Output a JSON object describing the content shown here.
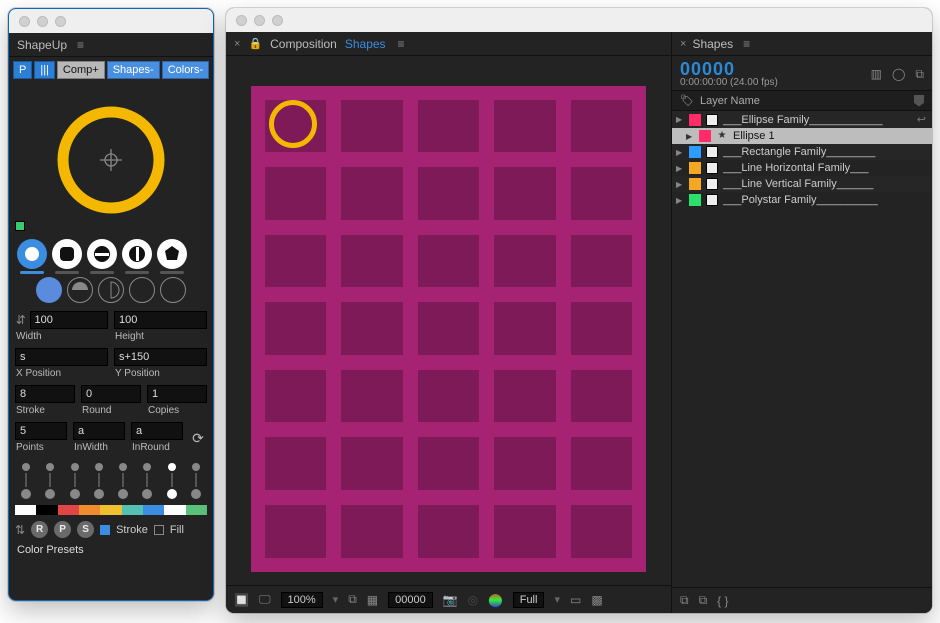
{
  "left_panel": {
    "title": "ShapeUp",
    "chips": [
      "P",
      "|||",
      "Comp+",
      "Shapes-",
      "Colors-"
    ],
    "width": {
      "value": "100",
      "label": "Width"
    },
    "height": {
      "value": "100",
      "label": "Height"
    },
    "xpos": {
      "value": "s",
      "label": "X Position"
    },
    "ypos": {
      "value": "s+150",
      "label": "Y Position"
    },
    "stroke": {
      "value": "8",
      "label": "Stroke"
    },
    "round": {
      "value": "0",
      "label": "Round"
    },
    "copies": {
      "value": "1",
      "label": "Copies"
    },
    "points": {
      "value": "5",
      "label": "Points"
    },
    "inwidth": {
      "value": "a",
      "label": "InWidth"
    },
    "inround": {
      "value": "a",
      "label": "InRound"
    },
    "btn_r": "R",
    "btn_p": "P",
    "btn_s": "S",
    "stroke_label": "Stroke",
    "fill_label": "Fill",
    "presets_label": "Color Presets",
    "palette": [
      "#ffffff",
      "#000000",
      "#e04646",
      "#f08b2e",
      "#f0c02e",
      "#55c1b0",
      "#3a8de0",
      "#ffffff",
      "#59c17a"
    ]
  },
  "composition": {
    "tab_label": "Composition",
    "link": "Shapes",
    "zoom": "100%",
    "timecode": "00000",
    "res": "Full"
  },
  "shapes_panel": {
    "tab_label": "Shapes",
    "timecode": "00000",
    "timecode_sub": "0:00:00:00 (24.00 fps)",
    "col_label": "Layer Name",
    "layers": [
      {
        "color": "#ff2b6b",
        "name": "___Ellipse Family____________",
        "shy": true
      },
      {
        "color": "#ff2b6b",
        "name": "Ellipse 1",
        "selected": true,
        "star": true,
        "indent": true
      },
      {
        "color": "#2e9bff",
        "name": "___Rectangle Family________"
      },
      {
        "color": "#f5a623",
        "name": "___Line Horizontal Family___"
      },
      {
        "color": "#f5a623",
        "name": "___Line Vertical Family______"
      },
      {
        "color": "#28e06a",
        "name": "___Polystar Family__________"
      }
    ]
  }
}
